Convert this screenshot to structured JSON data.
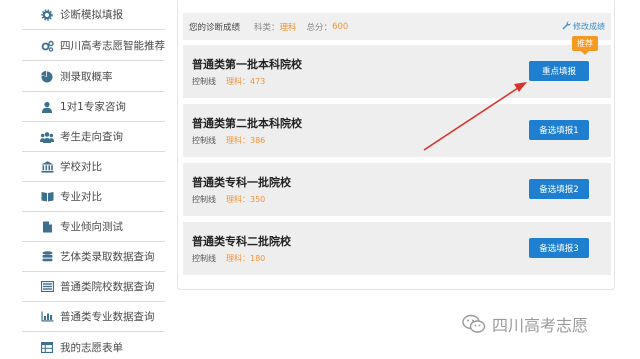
{
  "sidebar": {
    "items": [
      {
        "label": "诊断模拟填报",
        "icon": "gear-icon"
      },
      {
        "label": "四川高考志愿智能推荐",
        "icon": "gears-icon"
      },
      {
        "label": "测录取概率",
        "icon": "pie-chart-icon"
      },
      {
        "label": "1对1专家咨询",
        "icon": "user-icon"
      },
      {
        "label": "考生走向查询",
        "icon": "users-icon"
      },
      {
        "label": "学校对比",
        "icon": "bank-icon"
      },
      {
        "label": "专业对比",
        "icon": "book-icon"
      },
      {
        "label": "专业倾向测试",
        "icon": "document-icon"
      },
      {
        "label": "艺体类录取数据查询",
        "icon": "database-icon"
      },
      {
        "label": "普通类院校数据查询",
        "icon": "list-icon"
      },
      {
        "label": "普通类专业数据查询",
        "icon": "bar-chart-icon"
      },
      {
        "label": "我的志愿表单",
        "icon": "table-icon"
      }
    ]
  },
  "header": {
    "title": "您的诊断成绩",
    "subject_key": "科类：",
    "subject_value": "理科",
    "score_key": "总分：",
    "score_value": "600",
    "edit_label": "修改成绩"
  },
  "badge": "推荐",
  "cards": [
    {
      "name": "普通类第一批本科院校",
      "ctrl": "控制线",
      "kind": "理科：",
      "value": "473",
      "button": "重点填报"
    },
    {
      "name": "普通类第二批本科院校",
      "ctrl": "控制线",
      "kind": "理科：",
      "value": "386",
      "button": "备选填报1"
    },
    {
      "name": "普通类专科一批院校",
      "ctrl": "控制线",
      "kind": "理科：",
      "value": "350",
      "button": "备选填报2"
    },
    {
      "name": "普通类专科二批院校",
      "ctrl": "控制线",
      "kind": "理科：",
      "value": "180",
      "button": "备选填报3"
    }
  ],
  "watermark": "四川高考志愿",
  "colors": {
    "accent": "#1e7fd0",
    "orange": "#f0933a",
    "badge": "#f59a23",
    "arrow": "#d9342b",
    "icon": "#3d6f8f"
  }
}
